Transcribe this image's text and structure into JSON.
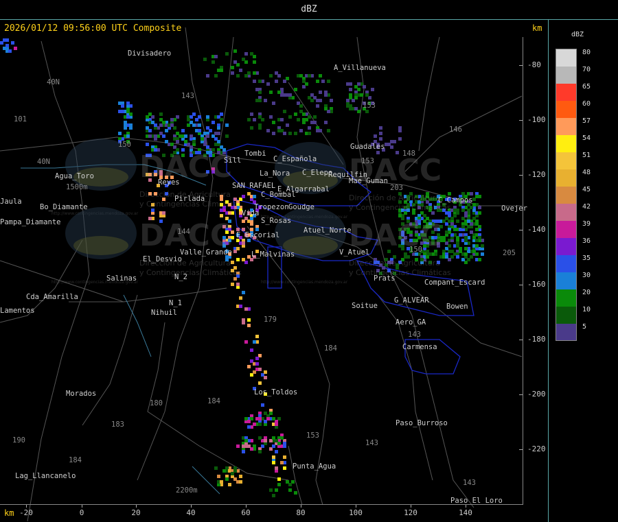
{
  "header": {
    "title": "dBZ"
  },
  "timestamp": "2026/01/12 09:56:00 UTC Composite",
  "axis": {
    "unit_top": "km",
    "unit_bottom": "km",
    "x_ticks": [
      "-20",
      "0",
      "20",
      "40",
      "60",
      "80",
      "100",
      "120",
      "140"
    ],
    "y_ticks": [
      "-80",
      "-100",
      "-120",
      "-140",
      "-160",
      "-180",
      "-200",
      "-220"
    ]
  },
  "legend": {
    "title": "dBZ",
    "levels": [
      {
        "value": "80",
        "color": "#d8d8d8"
      },
      {
        "value": "70",
        "color": "#b8b8b8"
      },
      {
        "value": "65",
        "color": "#ff3a2a"
      },
      {
        "value": "60",
        "color": "#ff5a10"
      },
      {
        "value": "57",
        "color": "#ff9a5a"
      },
      {
        "value": "54",
        "color": "#ffee10"
      },
      {
        "value": "51",
        "color": "#f4c43a"
      },
      {
        "value": "48",
        "color": "#e8b030"
      },
      {
        "value": "45",
        "color": "#d88a40"
      },
      {
        "value": "42",
        "color": "#c86a8a"
      },
      {
        "value": "39",
        "color": "#c81a9a"
      },
      {
        "value": "36",
        "color": "#7a1ad0"
      },
      {
        "value": "35",
        "color": "#2a50e8"
      },
      {
        "value": "30",
        "color": "#1a80d8"
      },
      {
        "value": "20",
        "color": "#0a8a0a"
      },
      {
        "value": "10",
        "color": "#0a5a0a"
      },
      {
        "value": "5",
        "color": "#4a3a8a"
      }
    ]
  },
  "watermark": {
    "text": "DACC",
    "sub1": "Dirección de Agricultura",
    "sub2": "y Contingencias Climáticas",
    "url": "http://www.contingencias.mendoza.gov.ar"
  },
  "places": [
    {
      "name": "Divisadero"
    },
    {
      "name": "A_Villanueva"
    },
    {
      "name": "Guadales"
    },
    {
      "name": "Agua_Toro"
    },
    {
      "name": "Jaula"
    },
    {
      "name": "Pampa_Diamante"
    },
    {
      "name": "Reyes"
    },
    {
      "name": "Pirlada"
    },
    {
      "name": "Sill"
    },
    {
      "name": "Tombi"
    },
    {
      "name": "C_Española"
    },
    {
      "name": "La_Nora"
    },
    {
      "name": "C_Bombal"
    },
    {
      "name": "C_Elepe"
    },
    {
      "name": "Requilfin"
    },
    {
      "name": "Mae_Guman"
    },
    {
      "name": "E_Algarrabal"
    },
    {
      "name": "SAN RAFAEL"
    },
    {
      "name": "C_Campos"
    },
    {
      "name": "Tropezon"
    },
    {
      "name": "Goudge"
    },
    {
      "name": "Vida"
    },
    {
      "name": "S_Rosas"
    },
    {
      "name": "Atuel_Norte"
    },
    {
      "name": "E_Escorial"
    },
    {
      "name": "Valle_Grande"
    },
    {
      "name": "L_Malvinas"
    },
    {
      "name": "El_Desvio"
    },
    {
      "name": "V_Atuel"
    },
    {
      "name": "Salinas"
    },
    {
      "name": "N_2"
    },
    {
      "name": "N_1"
    },
    {
      "name": "Nihuil"
    },
    {
      "name": "Prats"
    },
    {
      "name": "Compant_Escard"
    },
    {
      "name": "G_ALVEAR"
    },
    {
      "name": "Soitue"
    },
    {
      "name": "Bowen"
    },
    {
      "name": "Aero_GA"
    },
    {
      "name": "Carmensa"
    },
    {
      "name": "Cda_Amarilla"
    },
    {
      "name": "Lamentos"
    },
    {
      "name": "Morados"
    },
    {
      "name": "Los_Toldos"
    },
    {
      "name": "Paso_Burroso"
    },
    {
      "name": "Punta_Agua"
    },
    {
      "name": "Lag_Llancanelo"
    },
    {
      "name": "Paso_El_Loro"
    },
    {
      "name": "Ovejer"
    },
    {
      "name": "Bo_Diamante"
    }
  ],
  "road_numbers": [
    "143",
    "153",
    "146",
    "148",
    "153",
    "203",
    "205",
    "101",
    "40N",
    "40N",
    "150",
    "144",
    "179",
    "184",
    "180",
    "184",
    "183",
    "184",
    "190",
    "143",
    "153",
    "143",
    "143",
    "150",
    "2200m",
    "1500m"
  ]
}
